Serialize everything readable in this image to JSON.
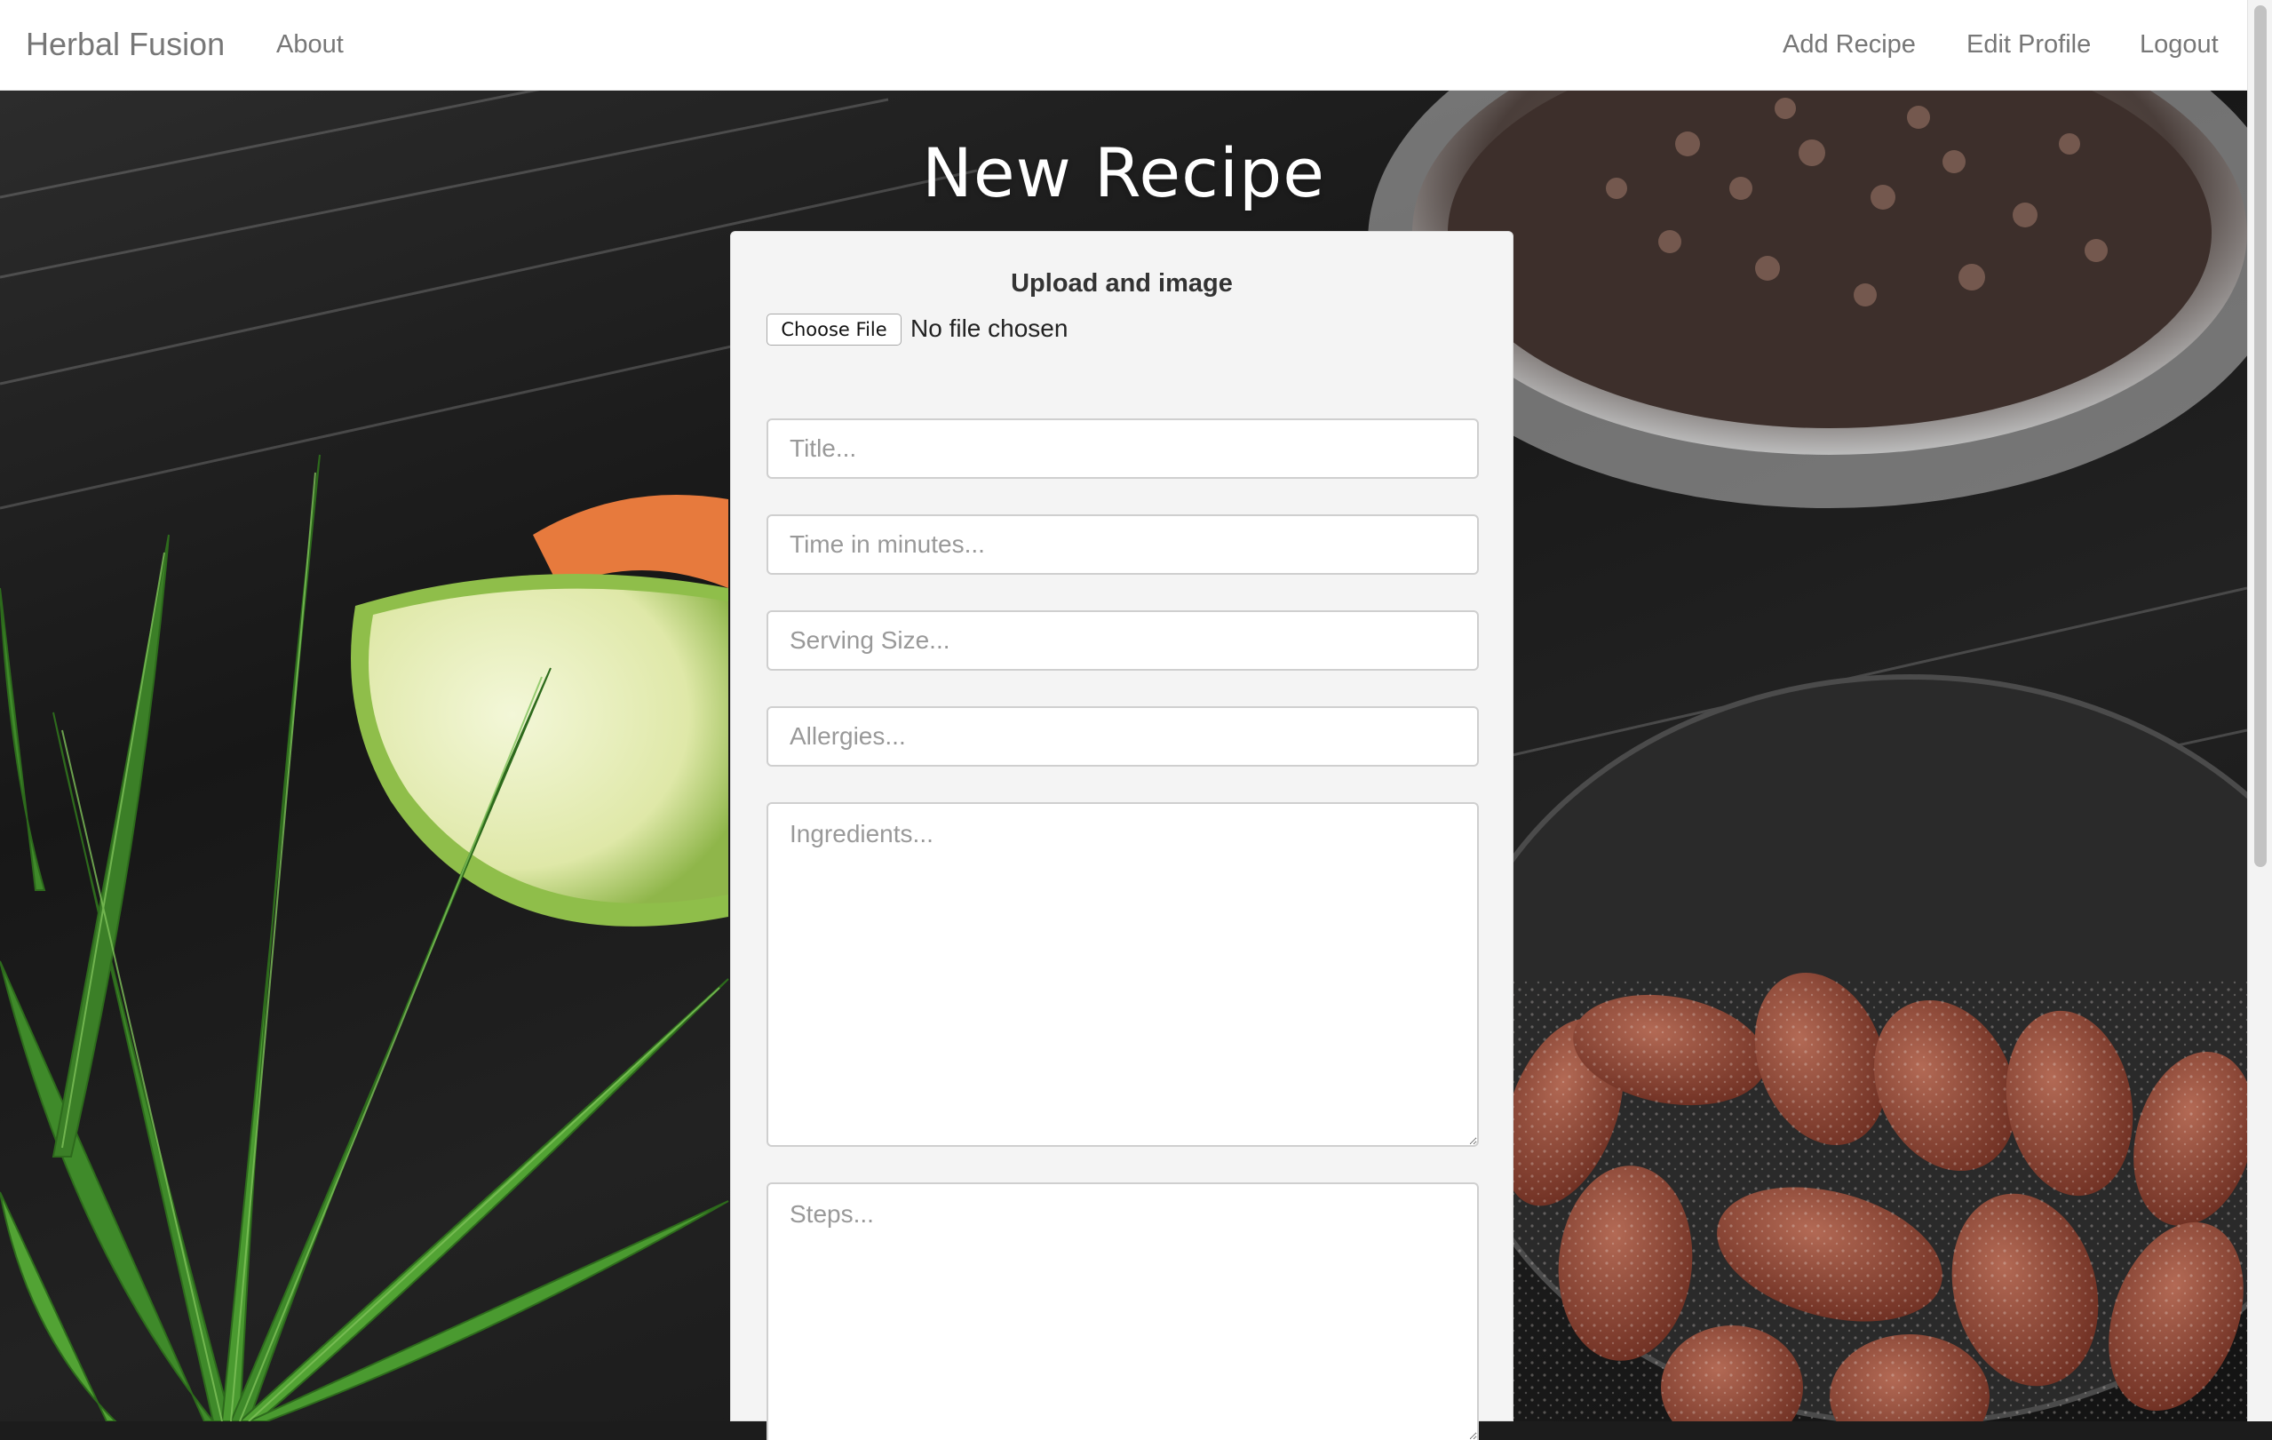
{
  "navbar": {
    "brand": "Herbal Fusion",
    "left_links": [
      {
        "label": "About"
      }
    ],
    "right_links": [
      {
        "label": "Add Recipe"
      },
      {
        "label": "Edit Profile"
      },
      {
        "label": "Logout"
      }
    ]
  },
  "page": {
    "title": "New Recipe"
  },
  "form": {
    "upload_label": "Upload and image",
    "file_button": "Choose File",
    "file_status": "No file chosen",
    "fields": {
      "title": {
        "value": "",
        "placeholder": "Title..."
      },
      "time": {
        "value": "",
        "placeholder": "Time in minutes..."
      },
      "serving": {
        "value": "",
        "placeholder": "Serving Size..."
      },
      "allergies": {
        "value": "",
        "placeholder": "Allergies..."
      },
      "ingredients": {
        "value": "",
        "placeholder": "Ingredients..."
      },
      "steps": {
        "value": "",
        "placeholder": "Steps..."
      }
    }
  },
  "colors": {
    "navbar_bg": "#ffffff",
    "nav_text": "#777777",
    "panel_bg": "#f4f4f4",
    "title_text": "#ffffff"
  }
}
